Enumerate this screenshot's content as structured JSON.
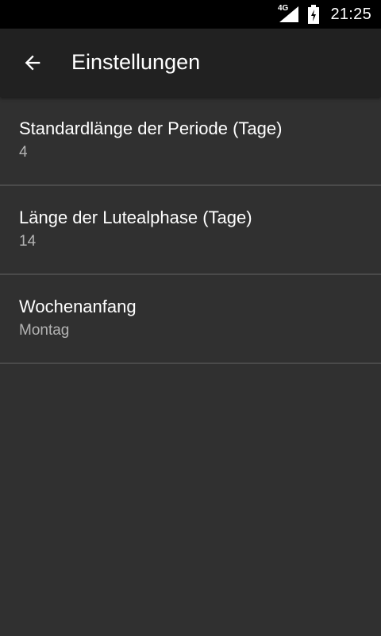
{
  "status_bar": {
    "network_type": "4G",
    "time": "21:25",
    "icons": [
      "signal-icon",
      "battery-icon"
    ]
  },
  "app_bar": {
    "back_icon": "arrow-back-icon",
    "title": "Einstellungen"
  },
  "preferences": [
    {
      "title": "Standardlänge der Periode (Tage)",
      "summary": "4"
    },
    {
      "title": "Länge der Lutealphase (Tage)",
      "summary": "14"
    },
    {
      "title": "Wochenanfang",
      "summary": "Montag"
    }
  ],
  "colors": {
    "background": "#303030",
    "app_bar": "#212121",
    "status_bar": "#000000",
    "divider": "#4a4a4a",
    "primary_text": "#ffffff",
    "secondary_text": "#b3b3b3"
  }
}
